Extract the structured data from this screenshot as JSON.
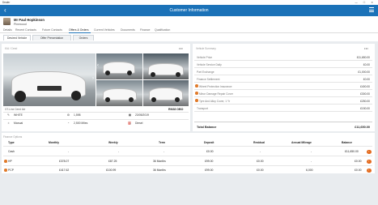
{
  "window": {
    "app_title": "Dealer",
    "controls": "—  ☐  ✕"
  },
  "navbar": {
    "title": "Customer Information"
  },
  "customer": {
    "name": "Mr Paul Hopkinson",
    "company": "Pinewood"
  },
  "tabs": [
    {
      "label": "Details",
      "active": false
    },
    {
      "label": "Recent Contacts",
      "active": false
    },
    {
      "label": "Future Contacts",
      "active": false
    },
    {
      "label": "Offers & Orders",
      "active": true
    },
    {
      "label": "Current Vehicles",
      "active": false
    },
    {
      "label": "Documents",
      "active": false
    },
    {
      "label": "Finance",
      "active": false
    },
    {
      "label": "Qualification",
      "active": false
    }
  ],
  "subtabs": [
    {
      "label": "Desired Vehicle",
      "active": true
    },
    {
      "label": "Offer Presentation",
      "active": false
    },
    {
      "label": "Orders",
      "active": false
    }
  ],
  "vehicle": {
    "section_label": "KIA / Ceed",
    "more": "•••",
    "caption": "GT-Line Ceed 4dr",
    "registration": "RK68 OBO",
    "specs": {
      "colour": "WHITE",
      "engine": "1,598",
      "date": "23/05/2019",
      "gearbox": "Manual",
      "mileage": "2,500 Miles",
      "fuel": "Diesel"
    }
  },
  "summary": {
    "section_label": "Vehicle Summary",
    "more": "•••",
    "rows": [
      {
        "label": "Vehicle Price",
        "value": "£11,650.00",
        "warn": false
      },
      {
        "label": "Vehicle Service Daily",
        "value": "£0.00",
        "warn": false
      },
      {
        "label": "Part Exchange",
        "value": "£1,000.00",
        "warn": false
      },
      {
        "label": "Finance Settlement",
        "value": "£0.00",
        "warn": false
      },
      {
        "label": "Wheel Protection Insurance",
        "value": "£400.00",
        "warn": true
      },
      {
        "label": "Minor Damage Repair Cover",
        "value": "£300.00",
        "warn": true
      },
      {
        "label": "Tyre And Alloy Cover, 1 Yr",
        "value": "£250.00",
        "warn": true
      },
      {
        "label": "Transport",
        "value": "£150.00",
        "warn": false
      }
    ],
    "total_label": "Total Balance",
    "total_value": "£11,650.00"
  },
  "finance": {
    "section_label": "Finance Options",
    "columns": [
      "Type",
      "Monthly",
      "Weekly",
      "Term",
      "Deposit",
      "Residual",
      "Annual Mileage",
      "Balance"
    ],
    "rows": [
      {
        "type": "Cash",
        "monthly": "-",
        "weekly": "-",
        "term": "-",
        "deposit": "£0.00",
        "residual": "-",
        "mileage": "-",
        "balance": "£11,650.00",
        "warn": false
      },
      {
        "type": "HP",
        "monthly": "£378.07",
        "weekly": "£87.25",
        "term": "36 Months",
        "deposit": "£99.00",
        "residual": "£0.00",
        "mileage": "-",
        "balance": "£0.00",
        "warn": true
      },
      {
        "type": "PCP",
        "monthly": "£417.62",
        "weekly": "£100.99",
        "term": "36 Months",
        "deposit": "£99.00",
        "residual": "£0.00",
        "mileage": "6,000",
        "balance": "£0.00",
        "warn": true
      }
    ]
  }
}
